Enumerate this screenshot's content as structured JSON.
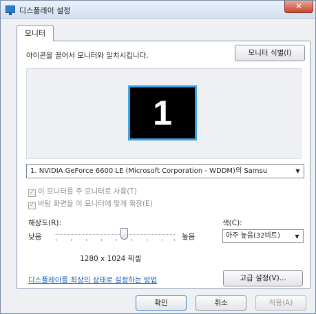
{
  "window": {
    "title": "디스플레이 설정",
    "close_symbol": "✕"
  },
  "tabs": [
    {
      "label": "모니터"
    }
  ],
  "instruction": "아이콘을 끌어서 모니터와 일치시킵니다.",
  "identify_button": "모니터 식별(I)",
  "monitor": {
    "number": "1"
  },
  "display_select": "1. NVIDIA GeForce 6600 LE (Microsoft Corporation - WDDM)의 Samsu",
  "checkboxes": [
    {
      "label": "이 모니터를 주 모니터로 사용(T)",
      "checked": true
    },
    {
      "label": "바탕 화면을 이 모니터에 맞게 확장(E)",
      "checked": true
    }
  ],
  "resolution": {
    "label": "해상도(R):",
    "low": "낮음",
    "high": "높음",
    "value_text": "1280 x 1024 픽셀"
  },
  "color": {
    "label": "색(C):",
    "selected": "아주 높음(32비트)"
  },
  "help_link": "디스플레이를 최상의 상태로 설정하는 방법",
  "advanced_button": "고급 설정(V)...",
  "footer": {
    "ok": "확인",
    "cancel": "취소",
    "apply": "적용(A)"
  },
  "icons": {
    "check": "✓",
    "dropdown_arrow": "▼"
  },
  "colors": {
    "monitor_border": "#38a4e8",
    "link": "#1a5fb4",
    "close": "#c8452f"
  }
}
